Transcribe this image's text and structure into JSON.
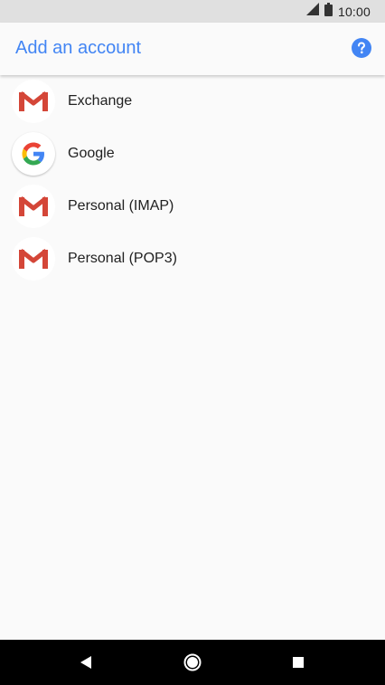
{
  "status_bar": {
    "time": "10:00",
    "icons": [
      "signal-icon",
      "battery-icon"
    ]
  },
  "app_bar": {
    "title": "Add an account",
    "help_icon": "help-icon"
  },
  "accounts": [
    {
      "label": "Exchange",
      "icon": "gmail-icon"
    },
    {
      "label": "Google",
      "icon": "google-icon"
    },
    {
      "label": "Personal (IMAP)",
      "icon": "gmail-icon"
    },
    {
      "label": "Personal (POP3)",
      "icon": "gmail-icon"
    }
  ],
  "nav_bar": {
    "icons": [
      "back-icon",
      "home-icon",
      "recents-icon"
    ]
  },
  "colors": {
    "accent": "#4285f4",
    "status_bar": "#e0e0e0",
    "background": "#fafafa",
    "nav_bar": "#000000",
    "gmail_red": "#d44638"
  }
}
